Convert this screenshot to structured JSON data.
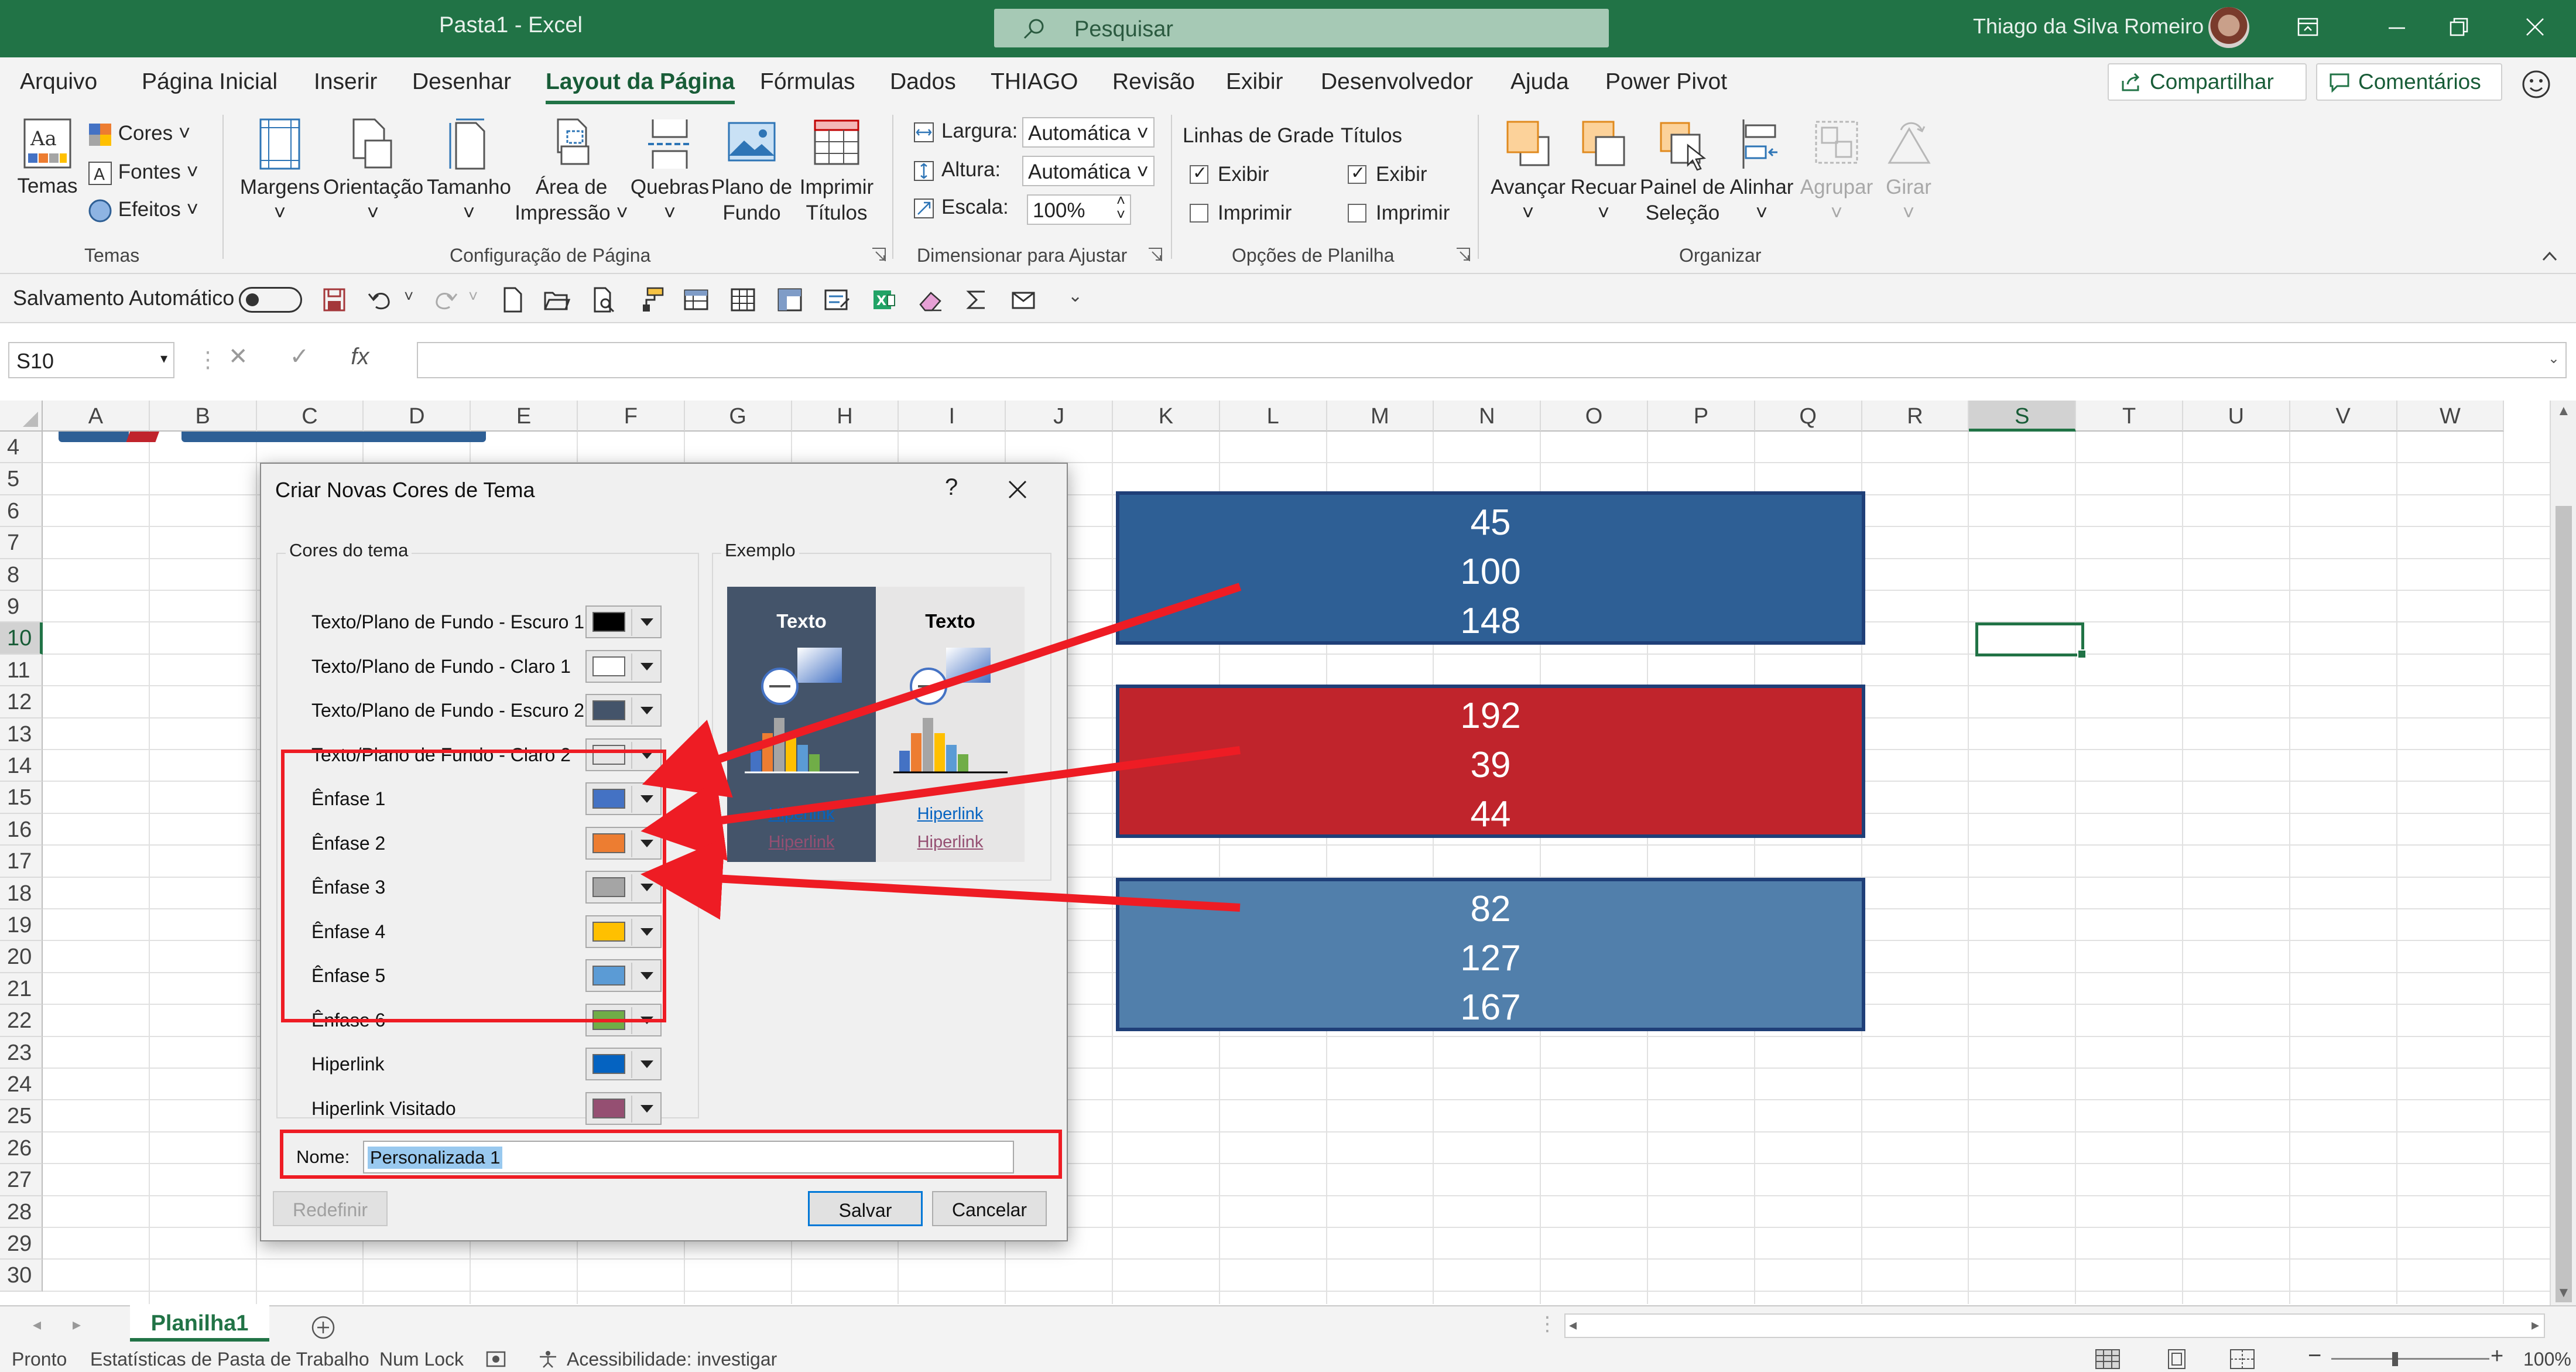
{
  "titlebar": {
    "title": "Pasta1  -  Excel",
    "search_placeholder": "Pesquisar",
    "user": "Thiago da Silva Romeiro"
  },
  "tabs": [
    "Arquivo",
    "Página Inicial",
    "Inserir",
    "Desenhar",
    "Layout da Página",
    "Fórmulas",
    "Dados",
    "THIAGO",
    "Revisão",
    "Exibir",
    "Desenvolvedor",
    "Ajuda",
    "Power Pivot"
  ],
  "active_tab": "Layout da Página",
  "share_label": "Compartilhar",
  "comments_label": "Comentários",
  "ribbon": {
    "temas": {
      "temas_label": "Temas",
      "cores": "Cores",
      "fontes": "Fontes",
      "efeitos": "Efeitos",
      "group": "Temas"
    },
    "config": {
      "margens": "Margens",
      "orientacao": "Orientação",
      "tamanho": "Tamanho",
      "area1": "Área de",
      "area2": "Impressão",
      "quebras": "Quebras",
      "plano1": "Plano de",
      "plano2": "Fundo",
      "imprimir1": "Imprimir",
      "imprimir2": "Títulos",
      "group": "Configuração de Página"
    },
    "ajustar": {
      "largura": "Largura:",
      "largura_val": "Automática",
      "altura": "Altura:",
      "altura_val": "Automática",
      "escala": "Escala:",
      "escala_val": "100%",
      "group": "Dimensionar para Ajustar"
    },
    "opcoes": {
      "linhas": "Linhas de Grade",
      "titulos": "Títulos",
      "exibir": "Exibir",
      "imprimir": "Imprimir",
      "group": "Opções de Planilha"
    },
    "organizar": {
      "avancar": "Avançar",
      "recuar": "Recuar",
      "painel1": "Painel de",
      "painel2": "Seleção",
      "alinhar": "Alinhar",
      "agrupar": "Agrupar",
      "girar": "Girar",
      "group": "Organizar"
    }
  },
  "qat": {
    "autosave": "Salvamento Automático"
  },
  "namebox": "S10",
  "columns": [
    "A",
    "B",
    "C",
    "D",
    "E",
    "F",
    "G",
    "H",
    "I",
    "J",
    "K",
    "L",
    "M",
    "N",
    "O",
    "P",
    "Q",
    "R",
    "S",
    "T",
    "U",
    "V",
    "W"
  ],
  "rows": [
    "4",
    "5",
    "6",
    "7",
    "8",
    "9",
    "10",
    "11",
    "12",
    "13",
    "14",
    "15",
    "16",
    "17",
    "18",
    "19",
    "20",
    "21",
    "22",
    "23",
    "24",
    "25",
    "26",
    "27",
    "28",
    "29",
    "30"
  ],
  "selected_col": "S",
  "selected_row": "10",
  "boxes": [
    {
      "lines": [
        "45",
        "100",
        "148"
      ],
      "color": "#2e5f95"
    },
    {
      "lines": [
        "192",
        "39",
        "44"
      ],
      "color": "#c0242c"
    },
    {
      "lines": [
        "82",
        "127",
        "167"
      ],
      "color": "#517fab"
    }
  ],
  "dialog": {
    "title": "Criar Novas Cores de Tema",
    "help": "?",
    "cores_legend": "Cores do tema",
    "exemplo_legend": "Exemplo",
    "items": [
      {
        "label": "Texto/Plano de Fundo - Escuro 1",
        "color": "#000000"
      },
      {
        "label": "Texto/Plano de Fundo - Claro 1",
        "color": "#ffffff"
      },
      {
        "label": "Texto/Plano de Fundo - Escuro 2",
        "color": "#44546a"
      },
      {
        "label": "Texto/Plano de Fundo - Claro 2",
        "color": "#e7e6e6"
      },
      {
        "label": "Ênfase 1",
        "color": "#4472c4"
      },
      {
        "label": "Ênfase 2",
        "color": "#ed7d31"
      },
      {
        "label": "Ênfase 3",
        "color": "#a5a5a5"
      },
      {
        "label": "Ênfase 4",
        "color": "#ffc000"
      },
      {
        "label": "Ênfase 5",
        "color": "#5b9bd5"
      },
      {
        "label": "Ênfase 6",
        "color": "#70ad47"
      },
      {
        "label": "Hiperlink",
        "color": "#0563c1"
      },
      {
        "label": "Hiperlink Visitado",
        "color": "#954f72"
      }
    ],
    "preview": {
      "texto": "Texto",
      "hiperlink": "Hiperlink"
    },
    "name_label": "Nome:",
    "name_value": "Personalizada 1",
    "redefinir": "Redefinir",
    "salvar": "Salvar",
    "cancelar": "Cancelar"
  },
  "sheet": "Planilha1",
  "status": {
    "pronto": "Pronto",
    "estat": "Estatísticas de Pasta de Trabalho",
    "numlock": "Num Lock",
    "acess": "Acessibilidade: investigar",
    "zoom": "100%"
  },
  "colors": {
    "excel_green": "#217346",
    "annotation_red": "#ee1c24"
  }
}
